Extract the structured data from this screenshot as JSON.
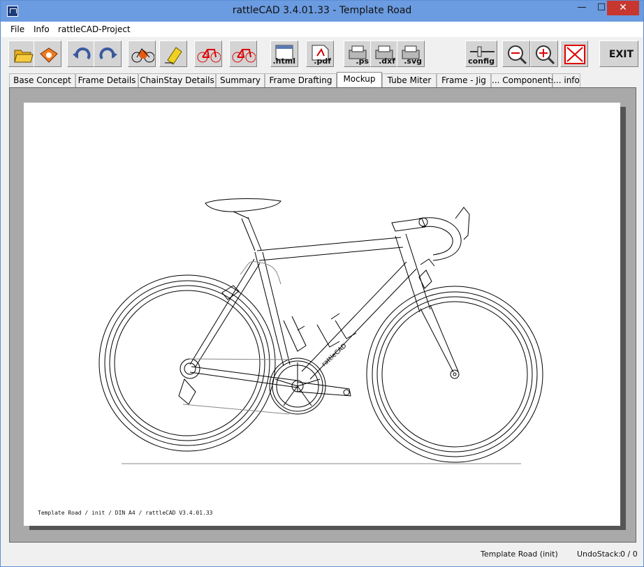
{
  "window": {
    "title": "rattleCAD  3.4.01.33 - Template Road"
  },
  "menu": [
    {
      "label": "File"
    },
    {
      "label": "Info"
    },
    {
      "label": "rattleCAD-Project"
    }
  ],
  "toolbar": {
    "html_label": ".html",
    "pdf_label": ".pdf",
    "ps_label": ".ps",
    "dxf_label": ".dxf",
    "svg_label": ".svg",
    "config_label": "config",
    "exit_label": "EXIT"
  },
  "tabs": [
    {
      "label": "Base Concept"
    },
    {
      "label": "Frame Details"
    },
    {
      "label": "ChainStay Details"
    },
    {
      "label": "Summary"
    },
    {
      "label": "Frame Drafting"
    },
    {
      "label": "Mockup",
      "active": true
    },
    {
      "label": "Tube Miter"
    },
    {
      "label": "Frame - Jig"
    },
    {
      "label": "... Components"
    },
    {
      "label": "... info"
    }
  ],
  "drawing": {
    "footer": "Template Road   /   init   / DIN A4 /   rattleCAD   V3.4.01.33",
    "downtube_text": "rattleCAD"
  },
  "status": {
    "project": "Template Road (init)",
    "undo_label": "UndoStack:",
    "undo_value": "0 / 0"
  }
}
